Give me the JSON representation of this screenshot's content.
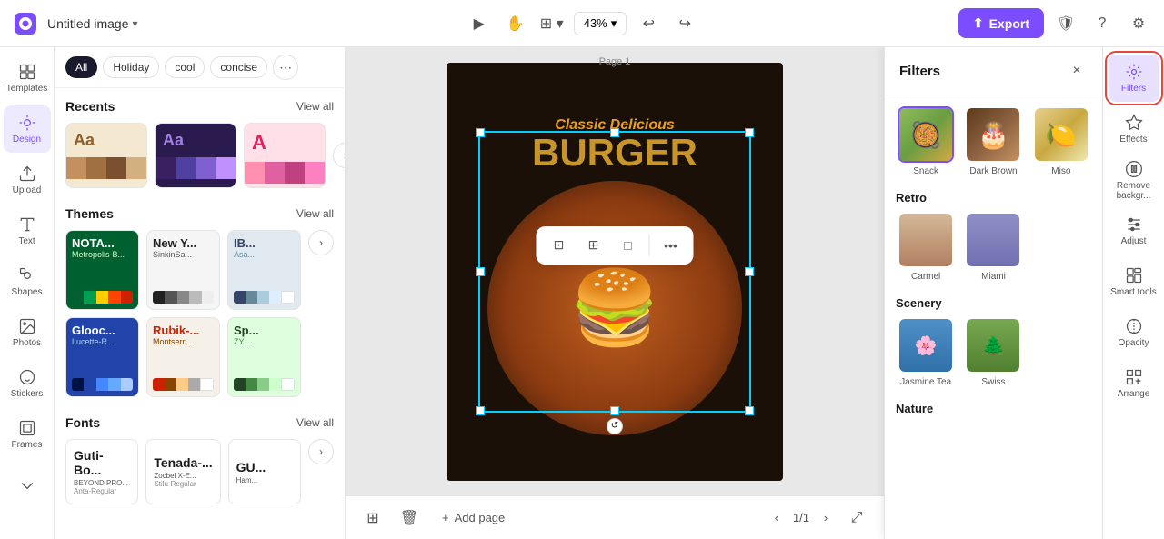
{
  "topbar": {
    "logo_alt": "Canva Logo",
    "file_title": "Untitled image",
    "zoom": "43%",
    "export_label": "Export",
    "undo_icon": "↩",
    "redo_icon": "↪"
  },
  "left_sidebar": {
    "items": [
      {
        "id": "templates",
        "label": "Templates",
        "icon": "template"
      },
      {
        "id": "design",
        "label": "Design",
        "icon": "design",
        "active": true
      },
      {
        "id": "uploads",
        "label": "Upload",
        "icon": "upload"
      },
      {
        "id": "text",
        "label": "Text",
        "icon": "text"
      },
      {
        "id": "shapes",
        "label": "Shapes",
        "icon": "shapes"
      },
      {
        "id": "photos",
        "label": "Photos",
        "icon": "photos"
      },
      {
        "id": "stickers",
        "label": "Stickers",
        "icon": "stickers"
      },
      {
        "id": "frames",
        "label": "Frames",
        "icon": "frames"
      },
      {
        "id": "more",
        "label": "",
        "icon": "chevron-down"
      }
    ]
  },
  "filter_tabs": {
    "tabs": [
      {
        "id": "all",
        "label": "All",
        "active": true
      },
      {
        "id": "holiday",
        "label": "Holiday"
      },
      {
        "id": "cool",
        "label": "cool"
      },
      {
        "id": "concise",
        "label": "concise"
      }
    ]
  },
  "recents": {
    "title": "Recents",
    "view_all": "View all",
    "items": [
      {
        "id": "r1",
        "header_text": "Aa",
        "bg": "#f5e8d0",
        "header_color": "#8b6030",
        "colors": [
          "#c49060",
          "#a07040",
          "#7a5030",
          "#d4b080"
        ]
      },
      {
        "id": "r2",
        "header_text": "Aa",
        "bg": "#2a1a4e",
        "header_color": "#a080e0",
        "colors": [
          "#3a2060",
          "#5040a0",
          "#8060d0",
          "#c090ff"
        ]
      },
      {
        "id": "r3",
        "header_text": "A",
        "bg": "#ffe0e8",
        "header_color": "#e02060",
        "colors": [
          "#ff90b0",
          "#e060a0",
          "#c04080",
          "#ff80c0"
        ]
      }
    ]
  },
  "themes": {
    "title": "Themes",
    "view_all": "View all",
    "items": [
      {
        "id": "t1",
        "title": "NOTA...",
        "sub": "Metropolis-B...",
        "bg": "#006030",
        "title_color": "#fff",
        "sub_color": "#ccffcc",
        "colors": [
          "#006030",
          "#00a050",
          "#ffcc00",
          "#ff4400",
          "#cc2200"
        ]
      },
      {
        "id": "t2",
        "title": "New Y...",
        "sub": "SinkinSa...",
        "bg": "#f5f5f5",
        "title_color": "#222",
        "sub_color": "#555",
        "colors": [
          "#222",
          "#555",
          "#888",
          "#bbb",
          "#eee"
        ]
      },
      {
        "id": "t3",
        "title": "IB...",
        "sub": "Asa...",
        "bg": "#e0e8f0",
        "title_color": "#334466",
        "sub_color": "#668899",
        "colors": [
          "#334466",
          "#668899",
          "#aaccdd",
          "#ddeeff",
          "#ffffff"
        ]
      },
      {
        "id": "t4",
        "title": "Glooc...",
        "sub": "Lucette-R...",
        "bg": "#2244aa",
        "title_color": "#fff",
        "sub_color": "#aaccff",
        "colors": [
          "#001144",
          "#2244aa",
          "#4488ff",
          "#66aaff",
          "#aaccff"
        ]
      },
      {
        "id": "t5",
        "title": "Rubik-...",
        "sub": "Montserr...",
        "bg": "#f5f0e8",
        "title_color": "#cc2200",
        "sub_color": "#884400",
        "colors": [
          "#cc2200",
          "#884400",
          "#ffcc88",
          "#aaaaaa",
          "#ffffff"
        ]
      },
      {
        "id": "t6",
        "title": "Sp...",
        "sub": "ZY...",
        "bg": "#ddffdd",
        "title_color": "#224422",
        "sub_color": "#448844",
        "colors": [
          "#224422",
          "#448844",
          "#88cc88",
          "#ccffcc",
          "#ffffff"
        ]
      }
    ]
  },
  "fonts": {
    "title": "Fonts",
    "view_all": "View all",
    "items": [
      {
        "id": "f1",
        "main": "Guti-Bo...",
        "sub1": "BEYOND PRO...",
        "sub2": "Anta-Regular",
        "bg": "#fff"
      },
      {
        "id": "f2",
        "main": "Tenada-...",
        "sub1": "Zocbel X-E...",
        "sub2": "Stilu-Regular",
        "bg": "#fff"
      },
      {
        "id": "f3",
        "main": "GU...",
        "sub1": "Ham...",
        "sub2": "",
        "bg": "#fff"
      }
    ]
  },
  "canvas": {
    "page_label": "Page 1",
    "design": {
      "subtitle": "Classic Delicious",
      "title": "BURGER"
    }
  },
  "filters_panel": {
    "title": "Filters",
    "close_icon": "×",
    "sections": [
      {
        "id": "top",
        "title": "",
        "items": [
          {
            "id": "snack",
            "label": "Snack",
            "selected": true
          },
          {
            "id": "dark_brown",
            "label": "Dark Brown"
          },
          {
            "id": "miso",
            "label": "Miso"
          }
        ]
      },
      {
        "id": "retro",
        "title": "Retro",
        "items": [
          {
            "id": "carmel",
            "label": "Carmel"
          },
          {
            "id": "miami",
            "label": "Miami"
          }
        ]
      },
      {
        "id": "scenery",
        "title": "Scenery",
        "items": [
          {
            "id": "jasmine_tea",
            "label": "Jasmine Tea"
          },
          {
            "id": "swiss",
            "label": "Swiss"
          }
        ]
      },
      {
        "id": "nature",
        "title": "Nature",
        "items": []
      }
    ]
  },
  "right_panel": {
    "items": [
      {
        "id": "filters",
        "label": "Filters",
        "active": true
      },
      {
        "id": "effects",
        "label": "Effects"
      },
      {
        "id": "remove_bg",
        "label": "Remove backgr..."
      },
      {
        "id": "adjust",
        "label": "Adjust"
      },
      {
        "id": "smart_tools",
        "label": "Smart tools"
      },
      {
        "id": "opacity",
        "label": "Opacity"
      },
      {
        "id": "arrange",
        "label": "Arrange"
      }
    ]
  },
  "bottom_bar": {
    "add_page": "Add page",
    "page_info": "1/1"
  }
}
